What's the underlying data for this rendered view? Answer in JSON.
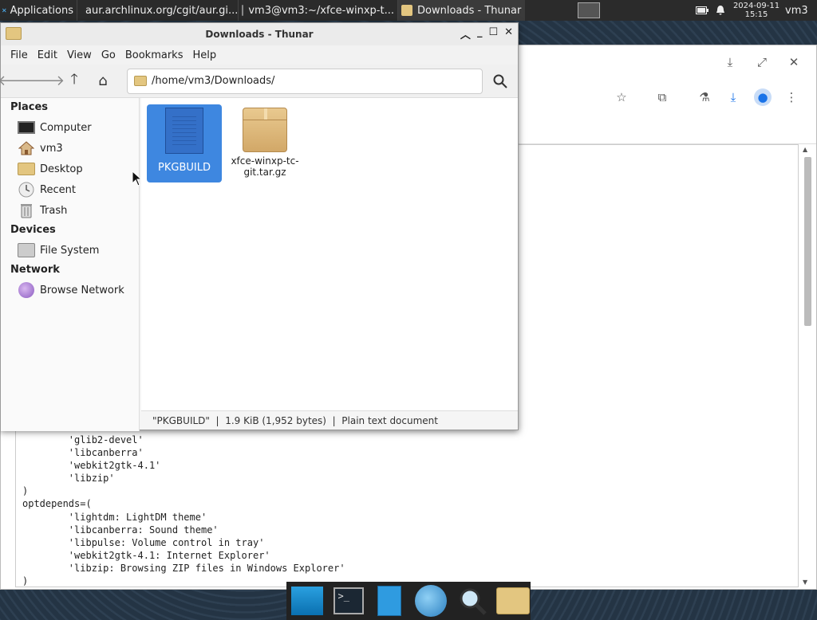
{
  "top_panel": {
    "apps_label": "Applications",
    "tasks": [
      {
        "label": "aur.archlinux.org/cgit/aur.gi..."
      },
      {
        "label": "vm3@vm3:~/xfce-winxp-t..."
      },
      {
        "label": "Downloads - Thunar"
      }
    ],
    "date": "2024-09-11",
    "time": "15:15",
    "user": "vm3"
  },
  "browser": {
    "code_lines": [
      "        'glib2-devel'",
      "        'libcanberra'",
      "        'webkit2gtk-4.1'",
      "        'libzip'",
      ")",
      "optdepends=(",
      "        'lightdm: LightDM theme'",
      "        'libcanberra: Sound theme'",
      "        'libpulse: Volume control in tray'",
      "        'webkit2gtk-4.1: Internet Explorer'",
      "        'libzip: Browsing ZIP files in Windows Explorer'",
      ")"
    ]
  },
  "thunar": {
    "title": "Downloads - Thunar",
    "menu": [
      "File",
      "Edit",
      "View",
      "Go",
      "Bookmarks",
      "Help"
    ],
    "path": "/home/vm3/Downloads/",
    "sidebar": {
      "places_header": "Places",
      "places": [
        "Computer",
        "vm3",
        "Desktop",
        "Recent",
        "Trash"
      ],
      "devices_header": "Devices",
      "devices": [
        "File System"
      ],
      "network_header": "Network",
      "network": [
        "Browse Network"
      ]
    },
    "files": [
      {
        "name": "PKGBUILD",
        "selected": true
      },
      {
        "name": "xfce-winxp-tc-git.tar.gz",
        "selected": false
      }
    ],
    "status": "\"PKGBUILD\"  |  1.9 KiB (1,952 bytes)  |  Plain text document"
  }
}
